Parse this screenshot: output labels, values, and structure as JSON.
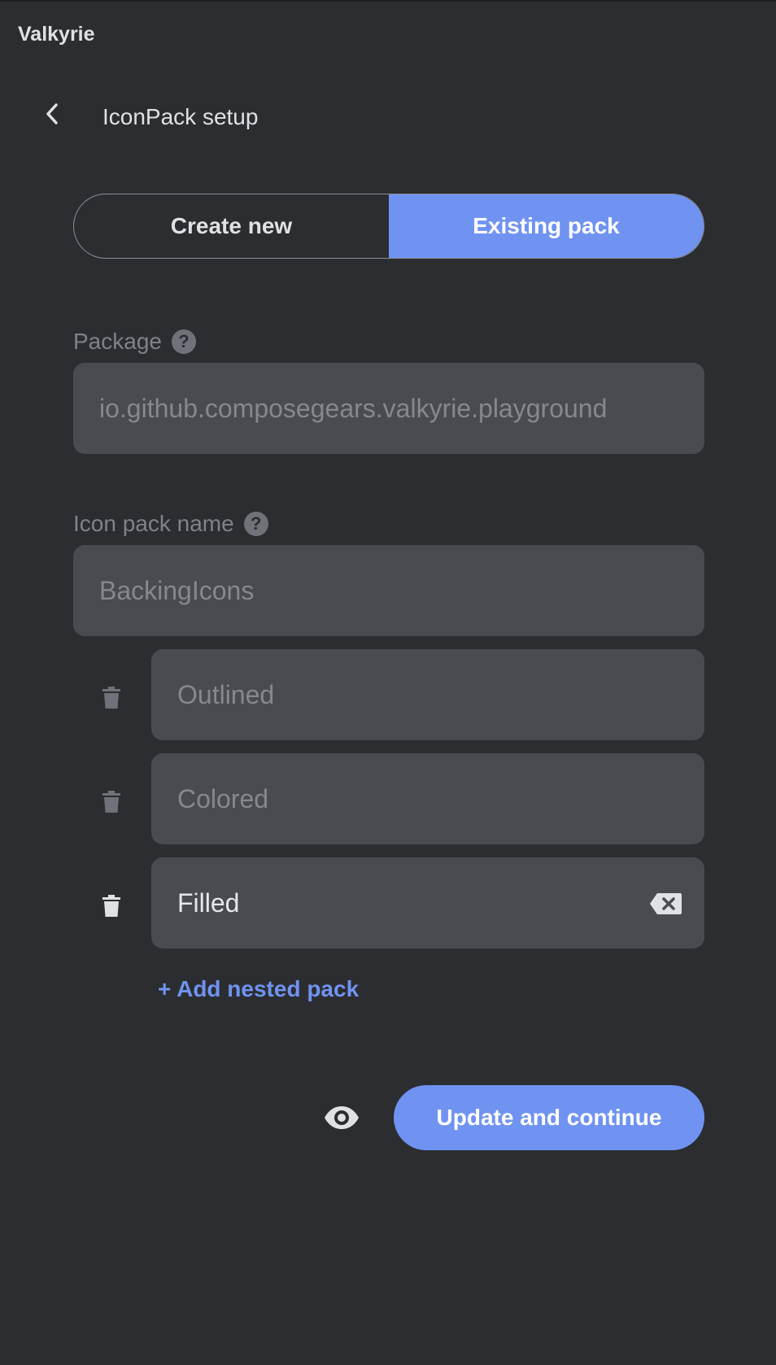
{
  "app": {
    "title": "Valkyrie"
  },
  "header": {
    "back_icon": "chevron-left-icon",
    "title": "IconPack setup"
  },
  "mode_toggle": {
    "options": [
      "Create new",
      "Existing pack"
    ],
    "selected": "Existing pack"
  },
  "package": {
    "label": "Package",
    "help_icon": "help-icon",
    "help_glyph": "?",
    "value": "io.github.composegears.valkyrie.playground"
  },
  "icon_pack_name": {
    "label": "Icon pack name",
    "help_icon": "help-icon",
    "help_glyph": "?",
    "value": "BackingIcons"
  },
  "nested_packs": [
    {
      "value": "Outlined",
      "delete_icon": "trash-icon"
    },
    {
      "value": "Colored",
      "delete_icon": "trash-icon"
    },
    {
      "value": "Filled",
      "delete_icon": "trash-icon",
      "focused": true,
      "clear_icon": "backspace-clear-icon"
    }
  ],
  "add_nested_pack_label": "+ Add nested pack",
  "footer": {
    "preview_icon": "eye-icon",
    "primary_label": "Update and continue"
  },
  "colors": {
    "background": "#2b2d30",
    "field": "#4a4b50",
    "accent": "#7093f2"
  }
}
